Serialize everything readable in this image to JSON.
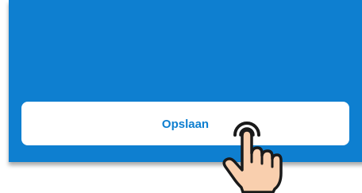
{
  "panel": {
    "background_color": "#0e7fd0"
  },
  "save_button": {
    "label": "Opslaan",
    "text_color": "#0e7fd0",
    "background_color": "#ffffff"
  },
  "cursor": {
    "icon": "tap-hand-icon",
    "fill_color": "#f9cfae",
    "outline_color": "#1a1a1a"
  }
}
